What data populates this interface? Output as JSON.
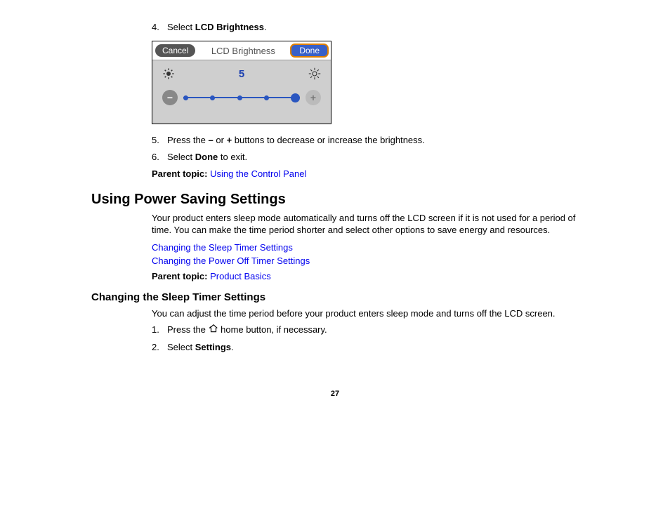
{
  "step4": {
    "num": "4.",
    "prefix": "Select ",
    "bold": "LCD Brightness",
    "suffix": "."
  },
  "lcd": {
    "cancel": "Cancel",
    "title": "LCD Brightness",
    "done": "Done",
    "value": "5"
  },
  "step5": {
    "num": "5.",
    "prefix": "Press the ",
    "bold1": "–",
    "mid": " or ",
    "bold2": "+",
    "suffix": " buttons to decrease or increase the brightness."
  },
  "step6": {
    "num": "6.",
    "prefix": "Select ",
    "bold": "Done",
    "suffix": " to exit."
  },
  "parent1": {
    "label": "Parent topic: ",
    "link": "Using the Control Panel"
  },
  "heading1": "Using Power Saving Settings",
  "para1": "Your product enters sleep mode automatically and turns off the LCD screen if it is not used for a period of time. You can make the time period shorter and select other options to save energy and resources.",
  "link1": "Changing the Sleep Timer Settings",
  "link2": "Changing the Power Off Timer Settings",
  "parent2": {
    "label": "Parent topic: ",
    "link": "Product Basics"
  },
  "heading2": "Changing the Sleep Timer Settings",
  "para2": "You can adjust the time period before your product enters sleep mode and turns off the LCD screen.",
  "substep1": {
    "num": "1.",
    "prefix": "Press the ",
    "suffix": " home button, if necessary."
  },
  "substep2": {
    "num": "2.",
    "prefix": "Select ",
    "bold": "Settings",
    "suffix": "."
  },
  "pageNumber": "27"
}
